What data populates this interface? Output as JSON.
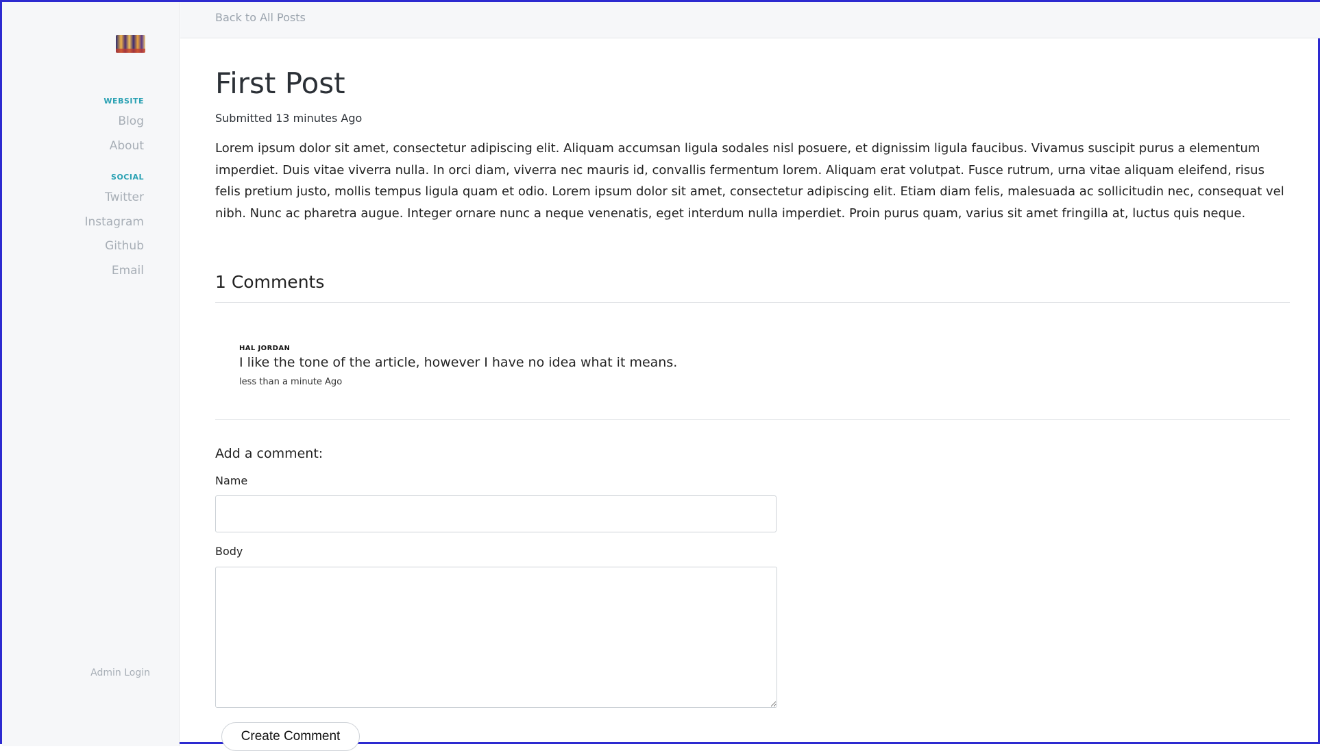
{
  "sidebar": {
    "logo_icon": "site-logo-icon",
    "website_label": "WEBSITE",
    "website_links": [
      "Blog",
      "About"
    ],
    "social_label": "SOCIAL",
    "social_links": [
      "Twitter",
      "Instagram",
      "Github",
      "Email"
    ],
    "admin_login": "Admin Login"
  },
  "topbar": {
    "back_link": "Back to All Posts"
  },
  "post": {
    "title": "First Post",
    "submitted": "Submitted 13 minutes Ago",
    "body": "Lorem ipsum dolor sit amet, consectetur adipiscing elit. Aliquam accumsan ligula sodales nisl posuere, et dignissim ligula faucibus. Vivamus suscipit purus a elementum imperdiet. Duis vitae viverra nulla. In orci diam, viverra nec mauris id, convallis fermentum lorem. Aliquam erat volutpat. Fusce rutrum, urna vitae aliquam eleifend, risus felis pretium justo, mollis tempus ligula quam et odio. Lorem ipsum dolor sit amet, consectetur adipiscing elit. Etiam diam felis, malesuada ac sollicitudin nec, consequat vel nibh. Nunc ac pharetra augue. Integer ornare nunc a neque venenatis, eget interdum nulla imperdiet. Proin purus quam, varius sit amet fringilla at, luctus quis neque."
  },
  "comments": {
    "heading": "1 Comments",
    "items": [
      {
        "author": "HAL JORDAN",
        "body": "I like the tone of the article, however I have no idea what it means.",
        "time": "less than a minute Ago"
      }
    ]
  },
  "form": {
    "heading": "Add a comment:",
    "name_label": "Name",
    "name_value": "",
    "body_label": "Body",
    "body_value": "",
    "submit_label": "Create Comment"
  },
  "colors": {
    "accent": "#2aa1b3",
    "muted_link": "#a7aeb6",
    "sidebar_bg": "#f6f7f9",
    "frame": "#2d2ad0"
  }
}
